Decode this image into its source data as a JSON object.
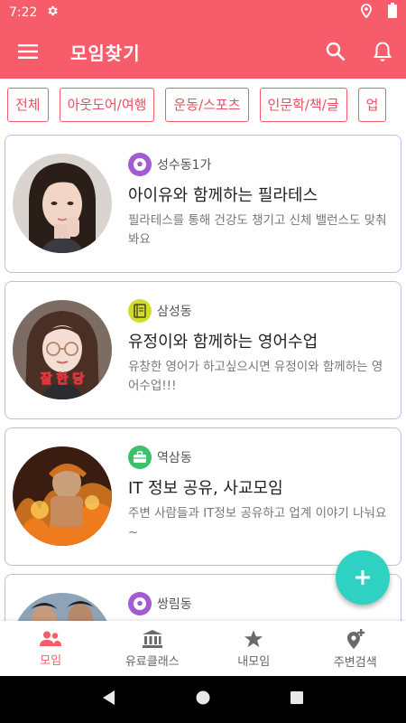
{
  "status_bar": {
    "time": "7:22"
  },
  "app_bar": {
    "title": "모임찾기"
  },
  "categories": [
    "전체",
    "아웃도어/여행",
    "운동/스포츠",
    "인문학/책/글",
    "업"
  ],
  "meetups": [
    {
      "location": "성수동1가",
      "category_icon": "soccer-ball-icon",
      "category_color": "#a35bd3",
      "title": "아이유와 함께하는 필라테스",
      "description": "필라테스를 통해 건강도 챙기고 신체 밸런스도 맞춰봐요"
    },
    {
      "location": "삼성동",
      "category_icon": "book-icon",
      "category_color": "#d4dc2a",
      "title": "유정이와 함께하는 영어수업",
      "description": "유창한 영어가 하고싶으시면 유정이와 함께하는 영어수업!!!",
      "avatar_caption": "잘 한 당"
    },
    {
      "location": "역삼동",
      "category_icon": "briefcase-icon",
      "category_color": "#3cc06a",
      "title": "IT 정보 공유, 사교모임",
      "description": "주변 사람들과 IT정보 공유하고 업계 이야기 나눠요~"
    },
    {
      "location": "쌍림동",
      "category_icon": "soccer-ball-icon",
      "category_color": "#a35bd3",
      "title": "",
      "description": ""
    }
  ],
  "bottom_nav": [
    {
      "label": "모임",
      "icon": "people-icon",
      "active": true
    },
    {
      "label": "유료클래스",
      "icon": "bank-icon",
      "active": false
    },
    {
      "label": "내모임",
      "icon": "star-icon",
      "active": false
    },
    {
      "label": "주변검색",
      "icon": "location-add-icon",
      "active": false
    }
  ],
  "colors": {
    "primary": "#f75c6a",
    "fab": "#2ed1c2",
    "card_border": "#c9b8ef"
  }
}
